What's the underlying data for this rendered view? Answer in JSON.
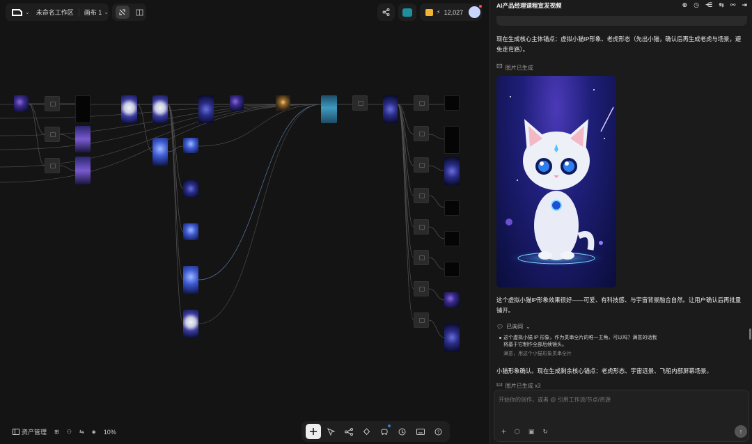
{
  "topbar": {
    "workspace_name": "未命名工作区",
    "canvas_name": "画布 1",
    "credits": "12,027"
  },
  "canvas": {
    "bottom_left": {
      "assets_label": "资产管理",
      "zoom": "10%"
    },
    "bottom_toolbar": {
      "tools": [
        "add-icon",
        "pointer-icon",
        "workflow-icon",
        "shapes-icon",
        "vehicle-icon",
        "history-icon",
        "keyboard-icon",
        "help-icon"
      ]
    }
  },
  "panel": {
    "title": "AI产品经理课程宣发视频",
    "message1": "现在生成核心主体锚点：虚拟小猫IP形象、老虎形态（先出小猫，确认后再生成老虎与场景，避免走弯路）。",
    "image_status": "图片已生成",
    "message2": "这个虚拟小猫IP形象效果很好——可爱、有科技感、与宇宙背景融合自然。让用户确认后再批量铺开。",
    "asked_label": "已询问",
    "question": "这个虚拟小猫 IP 形象，作为贯串全片的唯一主角，可以吗？满意的话我将基于它制作全部后续镜头。",
    "answer": "满意，用这个小猫形象贯串全片",
    "message3": "小猫形象确认。现在生成剩余核心锚点：老虎形态、宇宙远景、飞船内部屏幕场景。",
    "image_status2": "图片已生成 x3",
    "input_placeholder": "开始你的创作，或者 @ 引用工作流/节点/资源"
  },
  "colors": {
    "accent_blue": "#3a7bd5",
    "brand_teal": "#1f8f9d",
    "gold": "#f2b630"
  }
}
